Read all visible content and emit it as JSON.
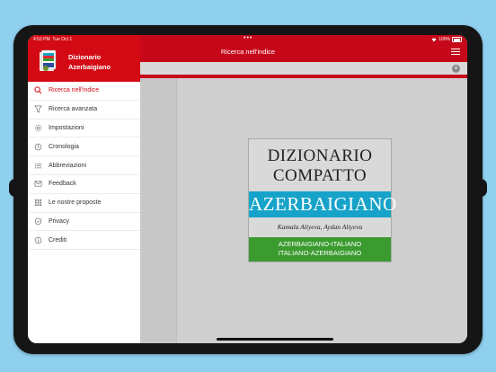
{
  "status_bar": {
    "time": "4:53 PM",
    "date": "Tue Oct 1",
    "dots": "•••",
    "battery": "100%"
  },
  "sidebar": {
    "app_name_line1": "Dizionario",
    "app_name_line2": "Azerbaigiano",
    "items": [
      {
        "label": "Ricerca nell'indice",
        "icon": "search-icon",
        "active": true
      },
      {
        "label": "Ricerca avanzata",
        "icon": "filter-icon",
        "active": false
      },
      {
        "label": "Impostazioni",
        "icon": "gear-icon",
        "active": false
      },
      {
        "label": "Cronologia",
        "icon": "history-icon",
        "active": false
      },
      {
        "label": "Abbreviazioni",
        "icon": "list-icon",
        "active": false
      },
      {
        "label": "Feedback",
        "icon": "mail-icon",
        "active": false
      },
      {
        "label": "Le nostre proposte",
        "icon": "grid-icon",
        "active": false
      },
      {
        "label": "Privacy",
        "icon": "shield-icon",
        "active": false
      },
      {
        "label": "Crediti",
        "icon": "info-icon",
        "active": false
      }
    ]
  },
  "main": {
    "title": "Ricerca nell'indice",
    "search": {
      "value": "",
      "placeholder": ""
    }
  },
  "book": {
    "line1": "DIZIONARIO",
    "line2": "COMPATTO",
    "language": "AZERBAIGIANO",
    "authors": "Kamala Aliyeva, Aydan Aliyeva",
    "sub1": "AZERBAIGIANO-ITALIANO",
    "sub2": "ITALIANO-AZERBAIGIANO"
  },
  "colors": {
    "brand_red": "#c6081a",
    "book_blue": "#17a3c9",
    "book_green": "#3b9b2f",
    "background": "#8fd0ee"
  }
}
